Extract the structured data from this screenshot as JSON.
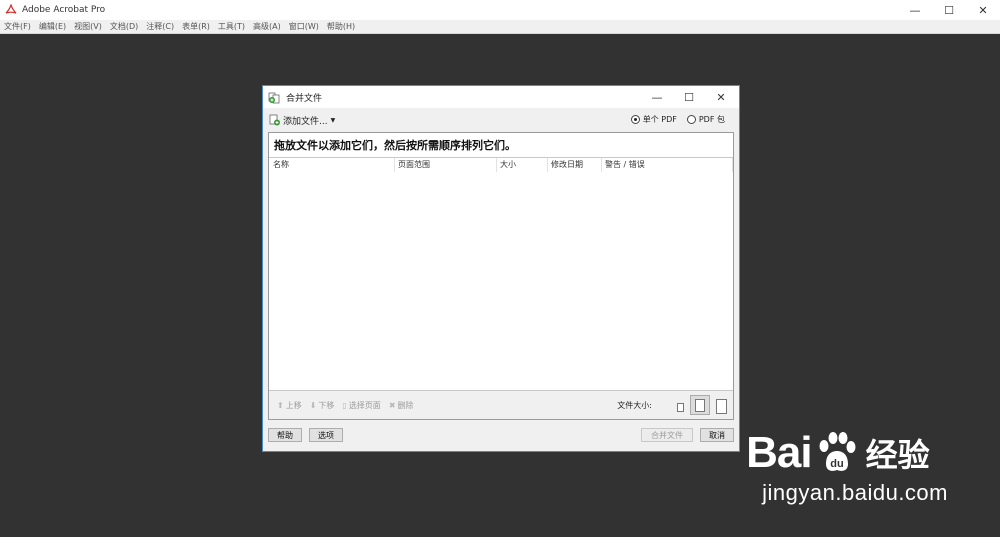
{
  "app": {
    "title": "Adobe Acrobat Pro",
    "window_controls": {
      "minimize": "—",
      "maximize": "☐",
      "close": "✕"
    }
  },
  "menubar": {
    "items": [
      "文件(F)",
      "编辑(E)",
      "视图(V)",
      "文档(D)",
      "注释(C)",
      "表单(R)",
      "工具(T)",
      "高级(A)",
      "窗口(W)",
      "帮助(H)"
    ]
  },
  "dialog": {
    "title": "合并文件",
    "window_controls": {
      "minimize": "—",
      "maximize": "☐",
      "close": "✕"
    },
    "add_files_label": "添加文件...",
    "output_options": [
      {
        "label": "单个 PDF",
        "selected": true
      },
      {
        "label": "PDF 包",
        "selected": false
      }
    ],
    "hint": "拖放文件以添加它们，然后按所需顺序排列它们。",
    "columns": [
      "名称",
      "页面范围",
      "大小",
      "修改日期",
      "警告 / 错误"
    ],
    "rows": [],
    "footer_buttons": {
      "move_up": "上移",
      "move_down": "下移",
      "choose_pages": "选择页面",
      "delete": "删除"
    },
    "file_size_label": "文件大小:",
    "file_size_selected": "medium",
    "help_button": "帮助",
    "options_button": "选项",
    "combine_button": "合并文件",
    "cancel_button": "取消"
  },
  "watermark": {
    "brand": "Bai",
    "brand_suffix": "du",
    "chinese": "经验",
    "url": "jingyan.baidu.com"
  },
  "colors": {
    "workspace": "#323232",
    "dialog_border": "#4a8ec9",
    "acrobat_red": "#d32f2f"
  }
}
